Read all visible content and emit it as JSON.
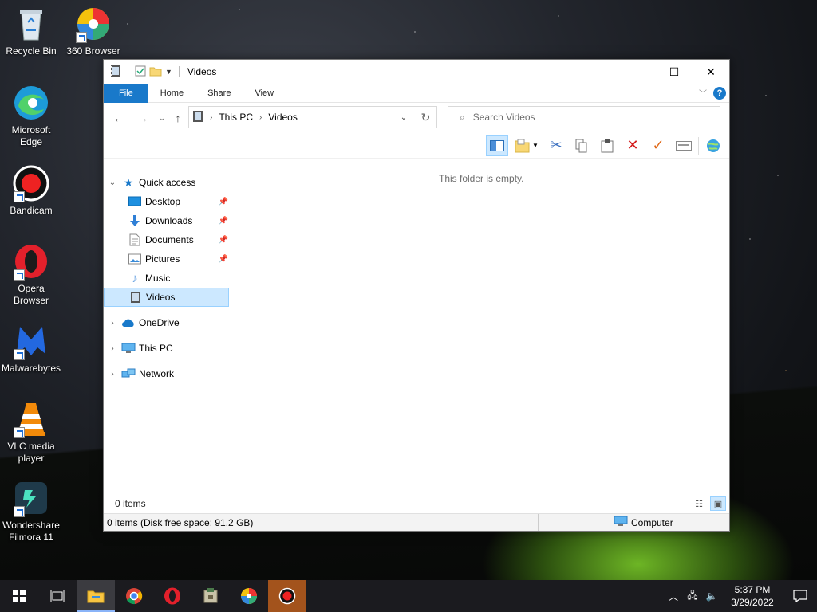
{
  "desktop": {
    "icons": [
      {
        "label": "Recycle Bin",
        "icon": "recycle-bin-icon"
      },
      {
        "label": "360 Browser",
        "icon": "360-browser-icon"
      },
      {
        "label": "Microsoft Edge",
        "icon": "edge-icon"
      },
      {
        "label": "Bandicam",
        "icon": "bandicam-icon"
      },
      {
        "label": "Opera Browser",
        "icon": "opera-icon"
      },
      {
        "label": "Malwarebytes",
        "icon": "malwarebytes-icon"
      },
      {
        "label": "VLC media player",
        "icon": "vlc-icon"
      },
      {
        "label": "Wondershare Filmora 11",
        "icon": "filmora-icon"
      }
    ]
  },
  "window": {
    "title": "Videos",
    "ribbon_tabs": [
      "File",
      "Home",
      "Share",
      "View"
    ],
    "address": {
      "crumbs": [
        "This PC",
        "Videos"
      ]
    },
    "search": {
      "placeholder": "Search Videos"
    },
    "empty_message": "This folder is empty.",
    "nav": {
      "quick_access": "Quick access",
      "pinned": [
        {
          "label": "Desktop",
          "icon": "desktop-folder-icon",
          "pinned": true
        },
        {
          "label": "Downloads",
          "icon": "downloads-folder-icon",
          "pinned": true
        },
        {
          "label": "Documents",
          "icon": "documents-folder-icon",
          "pinned": true
        },
        {
          "label": "Pictures",
          "icon": "pictures-folder-icon",
          "pinned": true
        },
        {
          "label": "Music",
          "icon": "music-folder-icon",
          "pinned": false
        },
        {
          "label": "Videos",
          "icon": "videos-folder-icon",
          "pinned": false
        }
      ],
      "roots": [
        "OneDrive",
        "This PC",
        "Network"
      ]
    },
    "items_count": "0 items",
    "status": {
      "left": "0 items (Disk free space: 91.2 GB)",
      "right": "Computer"
    }
  },
  "taskbar": {
    "apps": [
      "file-explorer-icon",
      "chrome-icon",
      "opera-icon",
      "archive-icon",
      "360-browser-icon",
      "bandicam-icon"
    ],
    "clock": {
      "time": "5:37 PM",
      "date": "3/29/2022"
    }
  },
  "colors": {
    "accent": "#1979ca",
    "selection": "#cce8ff",
    "taskbar": "#1b1b1f"
  }
}
